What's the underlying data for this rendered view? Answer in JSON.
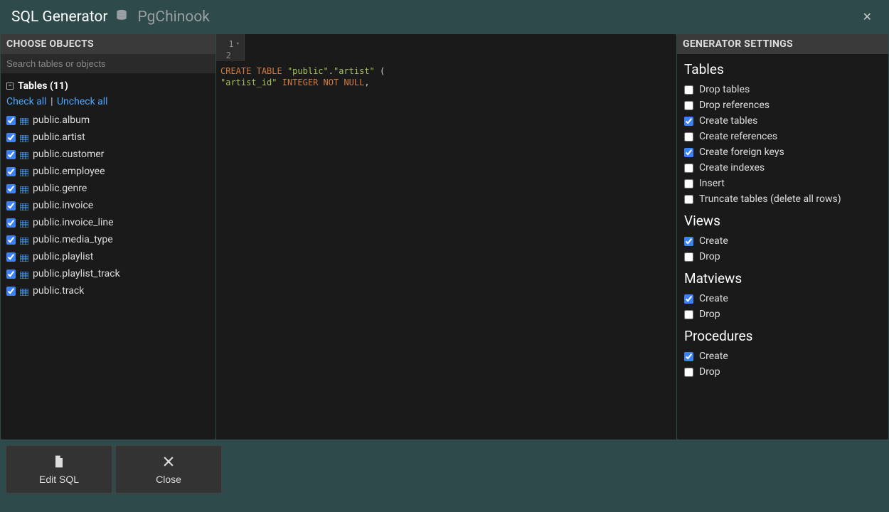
{
  "header": {
    "title": "SQL Generator",
    "db_name": "PgChinook"
  },
  "left": {
    "panel_title": "CHOOSE OBJECTS",
    "search_placeholder": "Search tables or objects",
    "tree_title": "Tables (11)",
    "check_all": "Check all",
    "uncheck_all": "Uncheck all",
    "tables": [
      {
        "name": "public.album",
        "checked": true
      },
      {
        "name": "public.artist",
        "checked": true
      },
      {
        "name": "public.customer",
        "checked": true
      },
      {
        "name": "public.employee",
        "checked": true
      },
      {
        "name": "public.genre",
        "checked": true
      },
      {
        "name": "public.invoice",
        "checked": true
      },
      {
        "name": "public.invoice_line",
        "checked": true
      },
      {
        "name": "public.media_type",
        "checked": true
      },
      {
        "name": "public.playlist",
        "checked": true
      },
      {
        "name": "public.playlist_track",
        "checked": true
      },
      {
        "name": "public.track",
        "checked": true
      }
    ]
  },
  "editor": {
    "lines": [
      {
        "num": "1",
        "fold": true,
        "tokens": [
          {
            "t": "CREATE",
            "c": "kw-orange"
          },
          {
            "t": " ",
            "c": ""
          },
          {
            "t": "TABLE",
            "c": "kw-orange"
          },
          {
            "t": " ",
            "c": ""
          },
          {
            "t": "\"public\"",
            "c": "str"
          },
          {
            "t": ".",
            "c": "punct"
          },
          {
            "t": "\"artist\"",
            "c": "str"
          },
          {
            "t": " (",
            "c": "punct"
          }
        ]
      },
      {
        "num": "2",
        "fold": false,
        "tokens": [
          {
            "t": "    ",
            "c": ""
          },
          {
            "t": "\"artist_id\"",
            "c": "str"
          },
          {
            "t": " ",
            "c": ""
          },
          {
            "t": "INTEGER",
            "c": "kw-orange"
          },
          {
            "t": " ",
            "c": ""
          },
          {
            "t": "NOT",
            "c": "kw-orange"
          },
          {
            "t": " ",
            "c": ""
          },
          {
            "t": "NULL",
            "c": "kw-orange"
          },
          {
            "t": ",",
            "c": "punct"
          }
        ]
      }
    ]
  },
  "right": {
    "panel_title": "GENERATOR SETTINGS",
    "sections": [
      {
        "title": "Tables",
        "items": [
          {
            "label": "Drop tables",
            "checked": false
          },
          {
            "label": "Drop references",
            "checked": false
          },
          {
            "label": "Create tables",
            "checked": true
          },
          {
            "label": "Create references",
            "checked": false
          },
          {
            "label": "Create foreign keys",
            "checked": true
          },
          {
            "label": "Create indexes",
            "checked": false
          },
          {
            "label": "Insert",
            "checked": false
          },
          {
            "label": "Truncate tables (delete all rows)",
            "checked": false
          }
        ]
      },
      {
        "title": "Views",
        "items": [
          {
            "label": "Create",
            "checked": true
          },
          {
            "label": "Drop",
            "checked": false
          }
        ]
      },
      {
        "title": "Matviews",
        "items": [
          {
            "label": "Create",
            "checked": true
          },
          {
            "label": "Drop",
            "checked": false
          }
        ]
      },
      {
        "title": "Procedures",
        "items": [
          {
            "label": "Create",
            "checked": true
          },
          {
            "label": "Drop",
            "checked": false
          }
        ]
      }
    ]
  },
  "footer": {
    "edit_label": "Edit SQL",
    "close_label": "Close"
  }
}
